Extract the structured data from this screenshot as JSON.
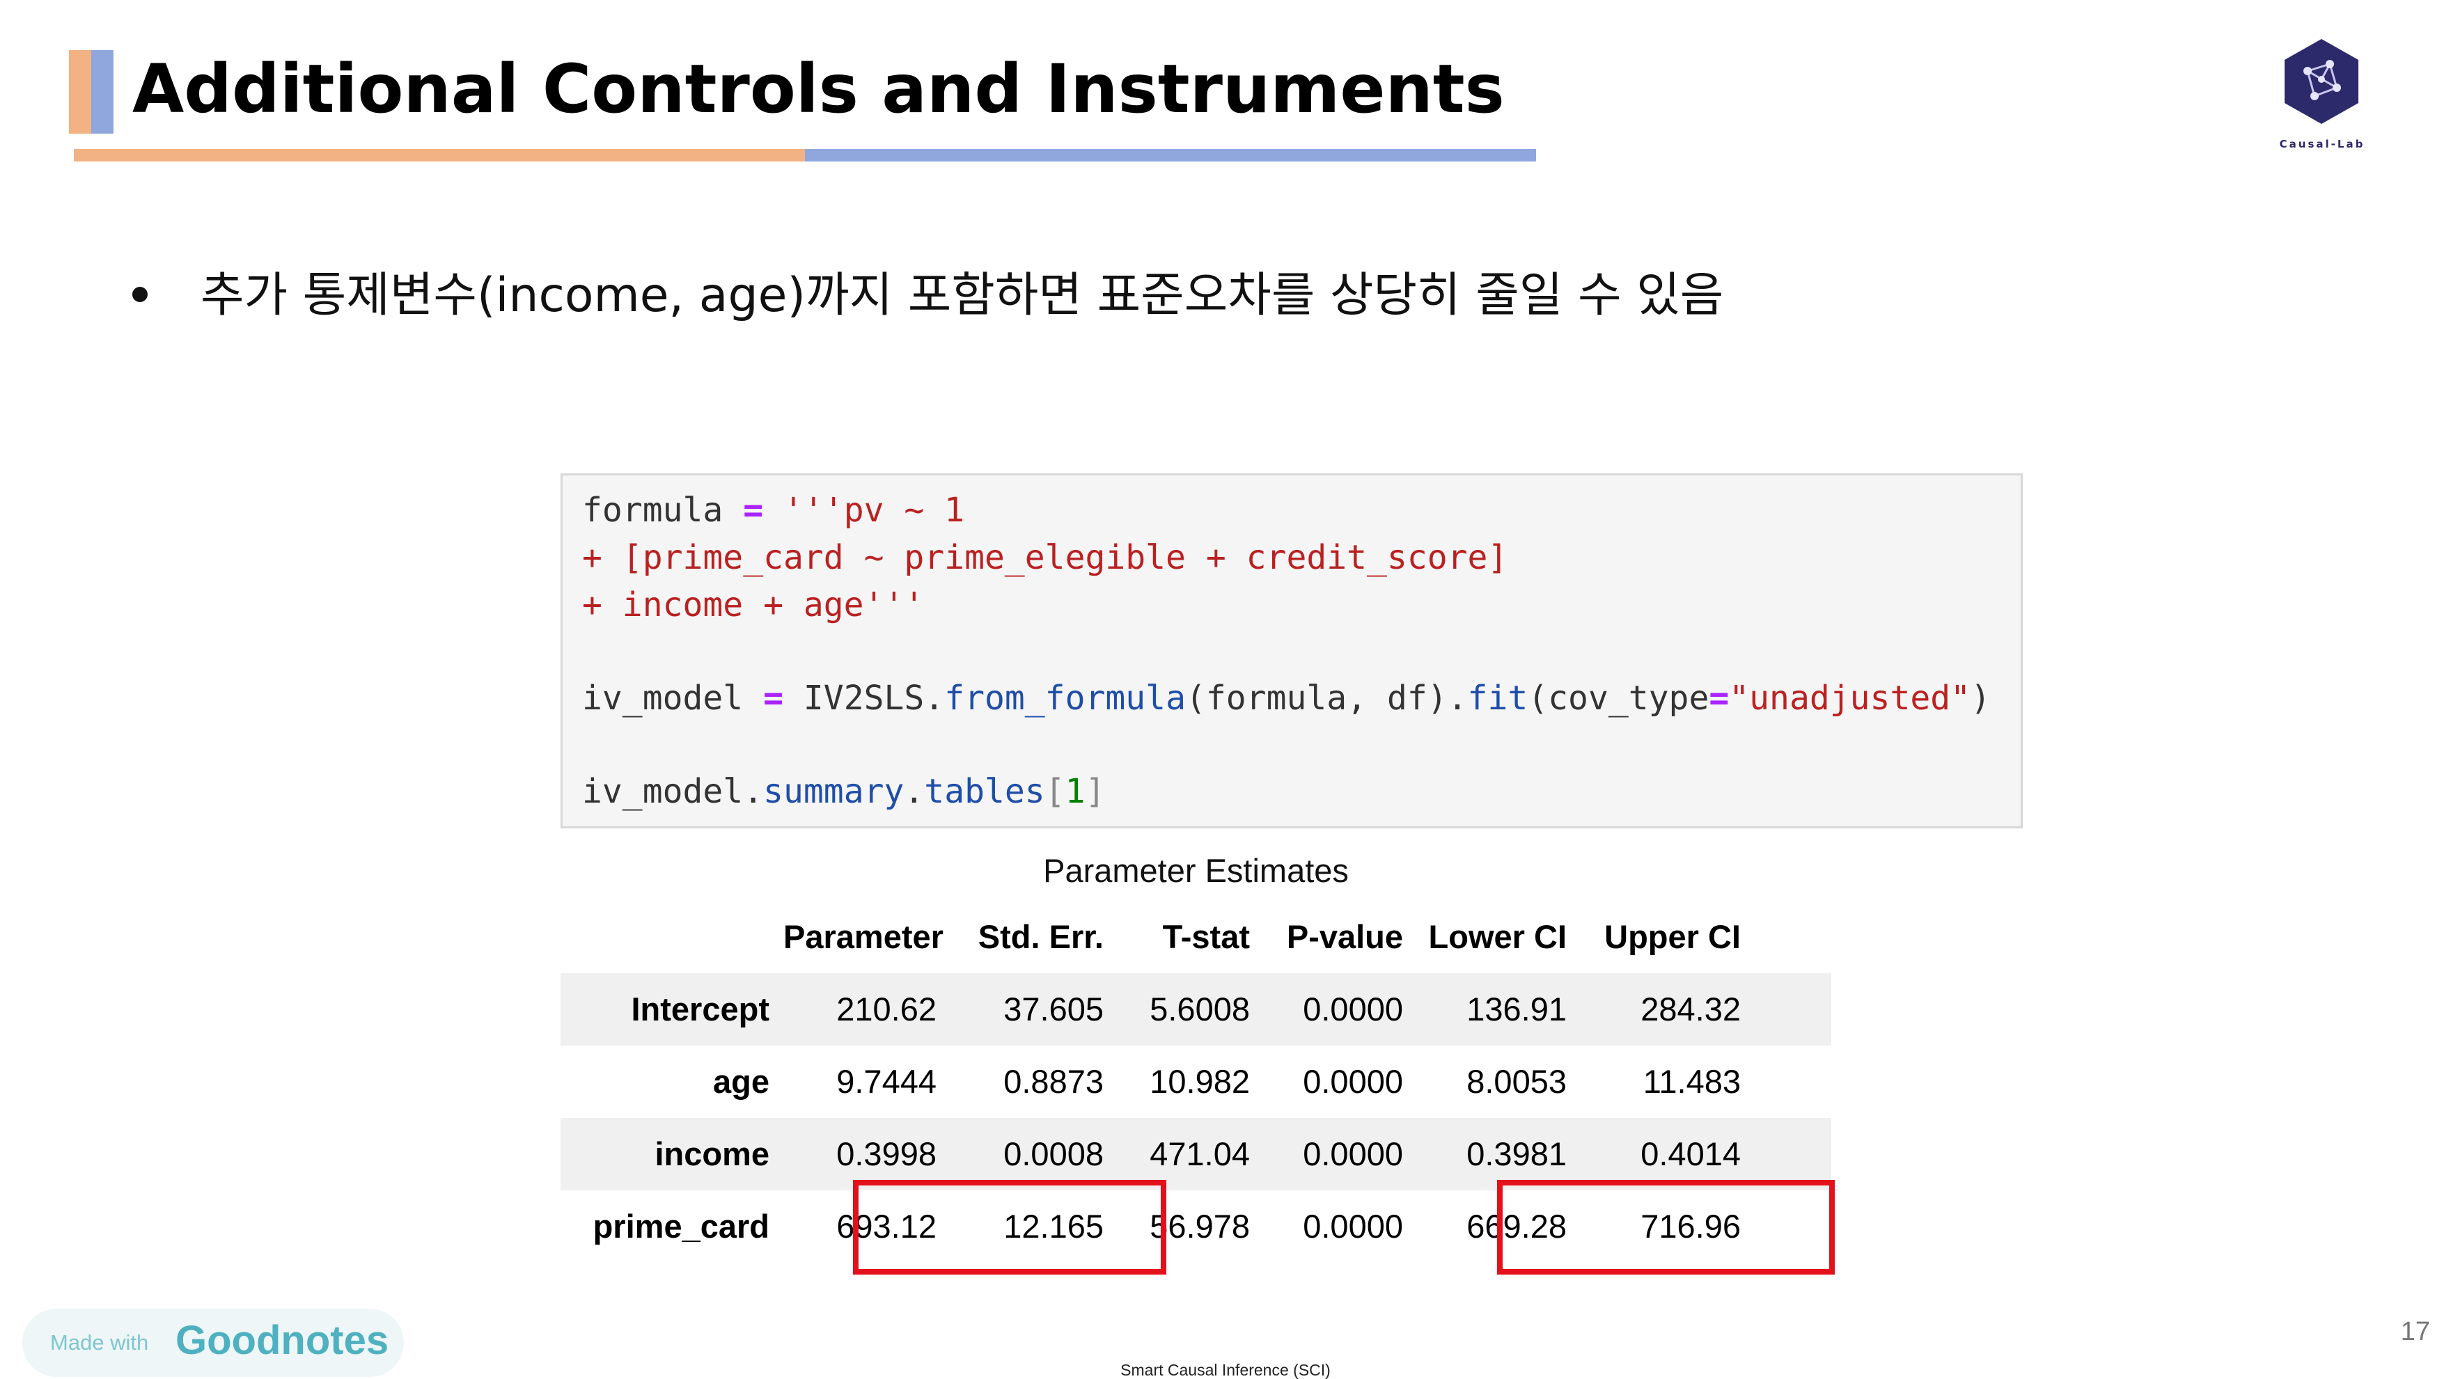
{
  "slide": {
    "title": "Additional Controls and Instruments",
    "logo_text": "Causal-Lab",
    "bullet": "추가 통제변수(income, age)까지 포함하면 표준오차를 상당히 줄일 수 있음",
    "page_number": "17",
    "footer": "Smart Causal Inference (SCI)"
  },
  "code": {
    "l1_a": "formula ",
    "l1_eq": "=",
    "l1_str": " '''pv ~ 1",
    "l2": "+ [prime_card ~ prime_elegible + credit_score]",
    "l3": "+ income + age'''",
    "l5_a": "iv_model ",
    "l5_eq": "=",
    "l5_b": " IV2SLS.",
    "l5_fn": "from_formula",
    "l5_c": "(formula, df).",
    "l5_fit": "fit",
    "l5_d": "(cov_type",
    "l5_eq2": "=",
    "l5_str": "\"unadjusted\"",
    "l5_e": ")",
    "l7_a": "iv_model.",
    "l7_b": "summary",
    "l7_dot": ".",
    "l7_c": "tables",
    "l7_lb": "[",
    "l7_idx": "1",
    "l7_rb": "]"
  },
  "table": {
    "caption": "Parameter Estimates",
    "headers": [
      "Parameter",
      "Std. Err.",
      "T-stat",
      "P-value",
      "Lower CI",
      "Upper CI"
    ],
    "rows": [
      {
        "label": "Intercept",
        "values": [
          "210.62",
          "37.605",
          "5.6008",
          "0.0000",
          "136.91",
          "284.32"
        ]
      },
      {
        "label": "age",
        "values": [
          "9.7444",
          "0.8873",
          "10.982",
          "0.0000",
          "8.0053",
          "11.483"
        ]
      },
      {
        "label": "income",
        "values": [
          "0.3998",
          "0.0008",
          "471.04",
          "0.0000",
          "0.3981",
          "0.4014"
        ]
      },
      {
        "label": "prime_card",
        "values": [
          "693.12",
          "12.165",
          "56.978",
          "0.0000",
          "669.28",
          "716.96"
        ]
      }
    ]
  },
  "goodnotes": {
    "made_with": "Made with",
    "brand": "Goodnotes"
  },
  "colors": {
    "accent_orange": "#f2b283",
    "accent_blue": "#8fa7dd",
    "highlight_red": "#e3111b"
  }
}
